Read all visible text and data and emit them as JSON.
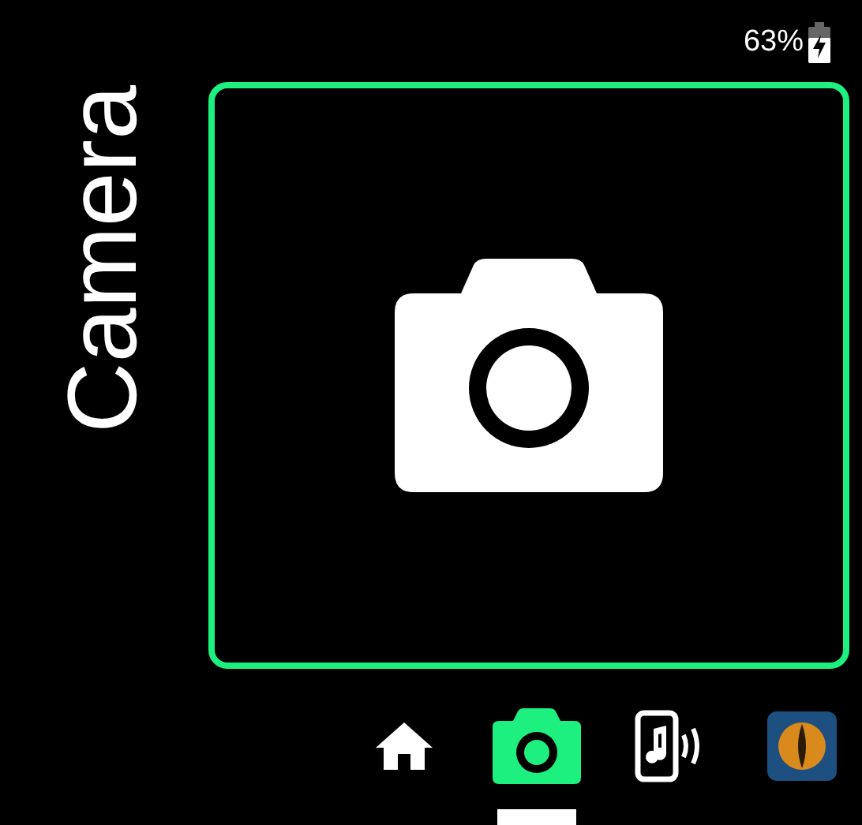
{
  "status_bar": {
    "battery": "63%",
    "charging": true
  },
  "title": "Camera",
  "panel": {
    "kind": "camera"
  },
  "nav": [
    {
      "kind": "home",
      "selected": false
    },
    {
      "kind": "camera",
      "selected": true
    },
    {
      "kind": "audio",
      "selected": false
    },
    {
      "kind": "app",
      "selected": false
    }
  ]
}
